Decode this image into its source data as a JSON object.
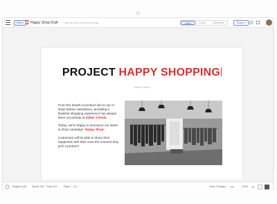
{
  "app": {
    "file_chip": "File ▾",
    "doc_title": "Happy Shop Draft",
    "doc_subtitle": "Last edit was a few seconds ago",
    "view_tabs": [
      "Editor",
      "Check",
      "Slideshow"
    ],
    "share_label": "Share ▾"
  },
  "slide": {
    "title_black": "PROJECT ",
    "title_red": "HAPPY SHOPPING",
    "author": "Author Name",
    "para1_text": "From the dearth of product line to our in-shop fashion assistance, providing a flawless shopping experience has always been our priority at ",
    "para1_red": "Zylker Trends.",
    "para2_text": "Today, we're happy to announce our latest in-shop campaign ",
    "para2_red": "'Happy Shop'.",
    "para3_text": "Customers will be able to share their happiness with their ones the moment they pick a product!",
    "image_icon": "clothing-store-photo"
  },
  "status": {
    "lang": "English (US)",
    "words": "Words 145",
    "chars": "Chars 812",
    "page_label": "Page",
    "page_num": "1",
    "page_total": "of 1",
    "track": "Track Changes",
    "zoom": "100%"
  },
  "colors": {
    "accent": "#d92f2f",
    "brand": "#3b5fb0"
  }
}
